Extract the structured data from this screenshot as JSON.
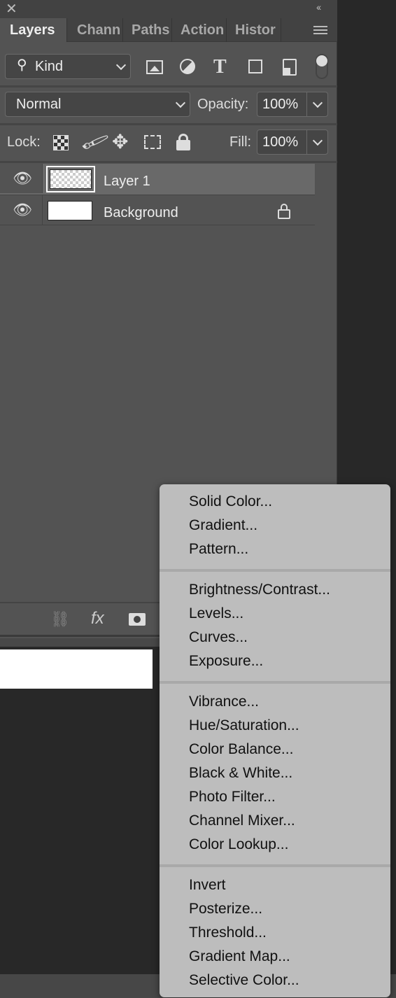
{
  "panel": {
    "tabs": [
      {
        "label": "Layers",
        "active": true
      },
      {
        "label": "Chann"
      },
      {
        "label": "Paths"
      },
      {
        "label": "Action"
      },
      {
        "label": "Histor"
      }
    ],
    "filter": {
      "value": "Kind",
      "icons": [
        "image-filter-icon",
        "adjustment-filter-icon",
        "type-filter-icon",
        "shape-filter-icon",
        "smart-object-filter-icon",
        "filter-toggle"
      ]
    },
    "blend_mode": "Normal",
    "opacity_label": "Opacity:",
    "opacity": "100%",
    "lock_label": "Lock:",
    "fill_label": "Fill:",
    "fill": "100%",
    "layers": [
      {
        "name": "Layer 1",
        "selected": true,
        "visible": true
      },
      {
        "name": "Background",
        "locked": true,
        "visible": true
      }
    ],
    "footer_icons": [
      "link-icon",
      "fx-icon",
      "mask-icon"
    ],
    "fx_label": "fx"
  },
  "menu": {
    "groups": [
      [
        "Solid Color...",
        "Gradient...",
        "Pattern..."
      ],
      [
        "Brightness/Contrast...",
        "Levels...",
        "Curves...",
        "Exposure..."
      ],
      [
        "Vibrance...",
        "Hue/Saturation...",
        "Color Balance...",
        "Black & White...",
        "Photo Filter...",
        "Channel Mixer...",
        "Color Lookup..."
      ],
      [
        "Invert",
        "Posterize...",
        "Threshold...",
        "Gradient Map...",
        "Selective Color..."
      ]
    ]
  }
}
